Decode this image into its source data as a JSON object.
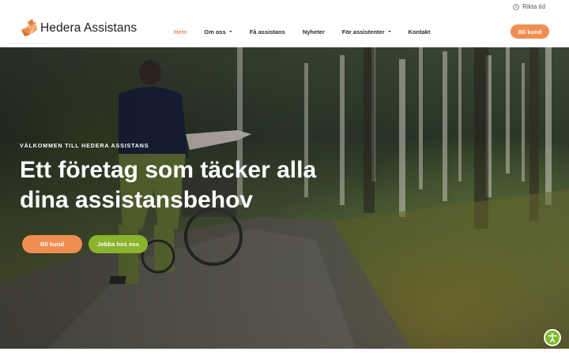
{
  "topbar": {
    "rikta_label": "Rikta tid",
    "rikta_icon": "clock-icon"
  },
  "header": {
    "logo_text": "Hedera Assistans",
    "logo_icon": "hedera-leaf-logo",
    "nav": [
      {
        "label": "Hem",
        "active": true,
        "dropdown": false
      },
      {
        "label": "Om oss",
        "active": false,
        "dropdown": true
      },
      {
        "label": "Få assistans",
        "active": false,
        "dropdown": false
      },
      {
        "label": "Nyheter",
        "active": false,
        "dropdown": false
      },
      {
        "label": "För assistenter",
        "active": false,
        "dropdown": true
      },
      {
        "label": "Kontakt",
        "active": false,
        "dropdown": false
      }
    ],
    "cta_label": "Bli kund"
  },
  "hero": {
    "kicker": "VÄLKOMMEN TILL HEDERA ASSISTANS",
    "headline": "Ett företag som täcker alla dina assistansbehov",
    "primary_button": "Bli kund",
    "secondary_button": "Jobba hos oss"
  },
  "accessibility": {
    "icon": "accessibility-icon"
  },
  "colors": {
    "accent_orange": "#f08e52",
    "accent_green": "#8bb42c",
    "active_nav": "#ee8a4e"
  }
}
